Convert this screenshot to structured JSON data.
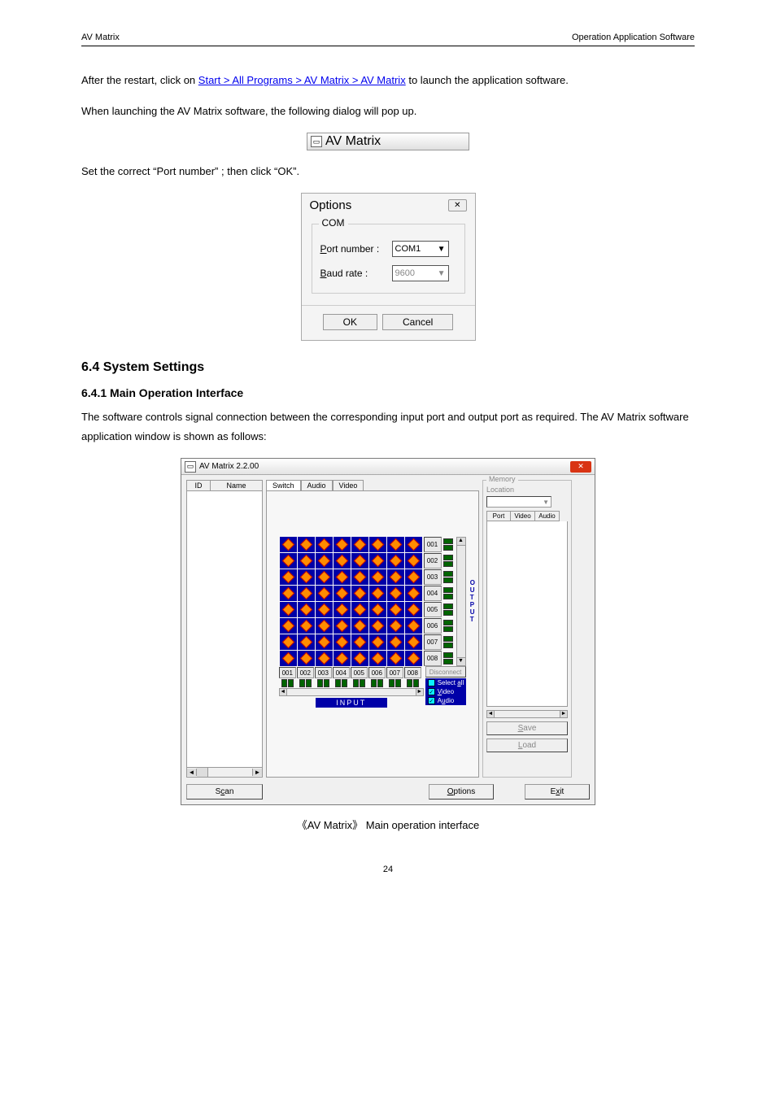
{
  "header": {
    "left": "AV Matrix",
    "right": "Operation Application Software"
  },
  "footer": "24",
  "para1_pre": "After the restart, click on ",
  "para1_a": "Start > All Programs > AV Matrix > AV Matrix",
  "para1_post": " to launch the application software.",
  "para2": "When launching the AV Matrix software, the following dialog will pop up.",
  "titlebar": "AV Matrix",
  "para3_a": "Set the correct ",
  "para3_b": "Port number",
  "para3_c": "; then click ",
  "para3_d": "OK",
  "para3_e": ".",
  "options": {
    "title": "Options",
    "com": "COM",
    "port_label": "Port number :",
    "port_value": "COM1",
    "baud_label": "Baud rate :",
    "baud_value": "9600",
    "ok": "OK",
    "cancel": "Cancel"
  },
  "para4": "The software controls signal connection between the corresponding input port and output port as required. The AV Matrix software application window is shown as follows:",
  "section": "6.4 System Settings",
  "subsection": "6.4.1 Main Operation Interface",
  "app": {
    "title": "AV Matrix 2.2.00",
    "id": "ID",
    "name": "Name",
    "tabs": [
      "Switch",
      "Audio",
      "Video"
    ],
    "out_labels": [
      "001",
      "002",
      "003",
      "004",
      "005",
      "006",
      "007",
      "008"
    ],
    "in_labels": [
      "001",
      "002",
      "003",
      "004",
      "005",
      "006",
      "007",
      "008"
    ],
    "output_v": [
      "O",
      "U",
      "T",
      "P",
      "U",
      "T"
    ],
    "disconnect": "Disconnect",
    "select_all": "Select all",
    "video_chk": "Video",
    "audio_chk": "Audio",
    "input_text": "INPUT",
    "memory": "Memory",
    "location": "Location",
    "port": "Port",
    "video": "Video",
    "audio": "Audio",
    "save": "Save",
    "load": "Load",
    "scan": "Scan",
    "options": "Options",
    "exit": "Exit"
  },
  "caption": "《AV Matrix》 Main operation interface"
}
